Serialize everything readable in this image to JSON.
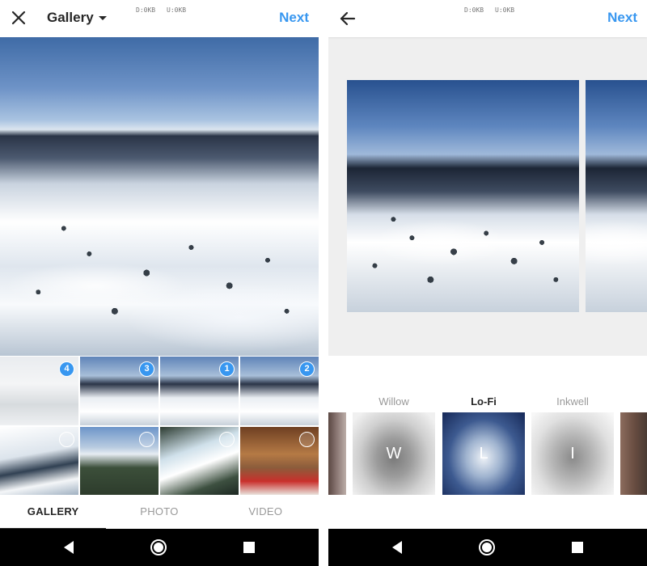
{
  "left": {
    "header": {
      "title": "Gallery",
      "status_d": "D:0KB",
      "status_u": "U:0KB",
      "next_label": "Next"
    },
    "thumbnails": [
      {
        "badge": "4",
        "selected": true
      },
      {
        "badge": "3",
        "selected": true
      },
      {
        "badge": "1",
        "selected": true
      },
      {
        "badge": "2",
        "selected": true
      },
      {
        "badge": "",
        "selected": false
      },
      {
        "badge": "",
        "selected": false
      },
      {
        "badge": "",
        "selected": false
      },
      {
        "badge": "",
        "selected": false
      }
    ],
    "tabs": [
      "GALLERY",
      "PHOTO",
      "VIDEO"
    ],
    "active_tab": "GALLERY"
  },
  "right": {
    "header": {
      "status_d": "D:0KB",
      "status_u": "U:0KB",
      "next_label": "Next"
    },
    "filters": [
      {
        "name": "Willow",
        "letter": "W"
      },
      {
        "name": "Lo-Fi",
        "letter": "L",
        "active": true
      },
      {
        "name": "Inkwell",
        "letter": "I"
      }
    ]
  },
  "colors": {
    "accent": "#3897f0",
    "text": "#262626",
    "muted": "#999999"
  },
  "icons": {
    "close": "close-icon",
    "dropdown": "caret-down-icon",
    "back": "arrow-back-icon",
    "nav_back": "nav-back-icon",
    "nav_home": "nav-home-icon",
    "nav_recent": "nav-recent-icon"
  }
}
